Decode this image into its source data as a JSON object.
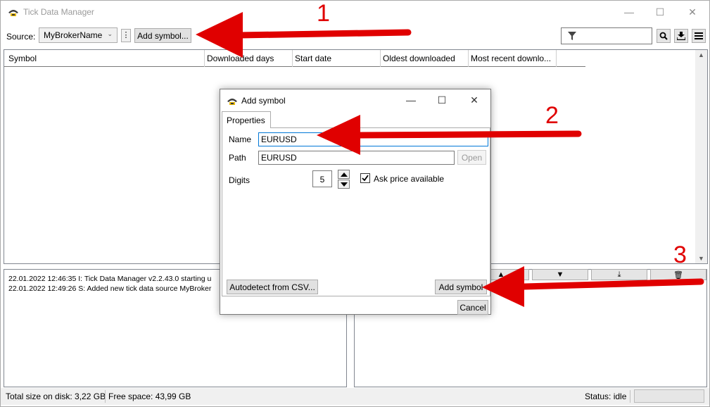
{
  "window": {
    "title": "Tick Data Manager",
    "controls": {
      "minimize": "—",
      "maximize": "☐",
      "close": "✕"
    }
  },
  "toolbar": {
    "source_label": "Source:",
    "source_value": "MyBrokerName",
    "more_icon": "⋮",
    "add_symbol_label": "Add symbol...",
    "filter_placeholder": "",
    "icons": [
      "filter-icon",
      "search-icon",
      "download-icon",
      "menu-icon"
    ]
  },
  "grid": {
    "columns": [
      "Symbol",
      "Downloaded days",
      "Start date",
      "Oldest downloaded",
      "Most recent downlo..."
    ]
  },
  "log": {
    "lines": [
      "22.01.2022 12:46:35  I: Tick Data Manager v2.2.43.0 starting u",
      "22.01.2022 12:49:26  S: Added new tick data source MyBroker"
    ]
  },
  "status": {
    "disk_total": "Total size on disk: 3,22 GB",
    "free_space": "Free space: 43,99 GB",
    "status_text": "Status: idle"
  },
  "dialog": {
    "title": "Add symbol",
    "tab_label": "Properties",
    "name_label": "Name",
    "name_value": "EURUSD",
    "path_label": "Path",
    "path_value": "EURUSD",
    "open_label": "Open",
    "digits_label": "Digits",
    "digits_value": "5",
    "ask_price_label": "Ask price available",
    "ask_price_checked": true,
    "autodetect_label": "Autodetect from CSV...",
    "add_symbol_label": "Add symbol",
    "cancel_label": "Cancel"
  },
  "annotations": {
    "labels": [
      "1",
      "2",
      "3"
    ],
    "color": "#e00000"
  }
}
